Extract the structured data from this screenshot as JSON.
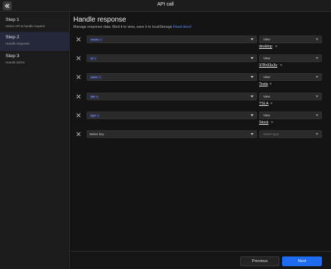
{
  "header": {
    "title": "API call"
  },
  "sidebar": {
    "steps": [
      {
        "title": "Step 1",
        "subtitle": "Select API & handle request"
      },
      {
        "title": "Step 2",
        "subtitle": "Handle response"
      },
      {
        "title": "Step 3",
        "subtitle": "Handle action"
      }
    ]
  },
  "main": {
    "heading": "Handle response",
    "subheading": "Manage response data. Bind it to view, save it to localStorage",
    "read_docs": "Read docs!",
    "rows": [
      {
        "key": "results",
        "view": "View",
        "value": "desktop"
      },
      {
        "key": "id",
        "view": "View",
        "value": "37Br93u3v"
      },
      {
        "key": "name",
        "view": "View",
        "value": "Tesla"
      },
      {
        "key": "title",
        "view": "View",
        "value": "TSLA"
      },
      {
        "key": "type",
        "view": "View",
        "value": "Stock"
      }
    ],
    "empty_row": {
      "key_placeholder": "Select key",
      "type_placeholder": "Select type"
    }
  },
  "footer": {
    "previous_label": "Previous",
    "next_label": "Next"
  }
}
